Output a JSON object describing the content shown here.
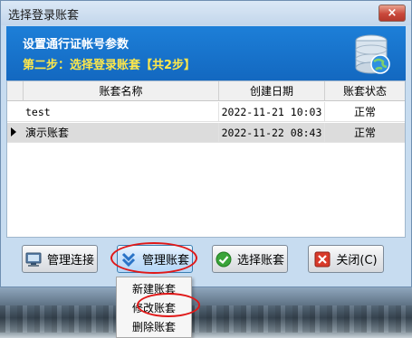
{
  "window": {
    "title": "选择登录账套",
    "close_label": "×"
  },
  "banner": {
    "title": "设置通行证帐号参数",
    "step": "第二步：选择登录账套【共2步】",
    "icon": "database-globe-icon"
  },
  "grid": {
    "columns": [
      "账套名称",
      "创建日期",
      "账套状态"
    ],
    "rows": [
      {
        "name": "test",
        "date": "2022-11-21 10:03",
        "status": "正常",
        "selected": false
      },
      {
        "name": "演示账套",
        "date": "2022-11-22 08:43",
        "status": "正常",
        "selected": true
      }
    ]
  },
  "buttons": {
    "manage_conn": "管理连接",
    "manage_ledger": "管理账套",
    "select_ledger": "选择账套",
    "close": "关闭(C)"
  },
  "menu": {
    "items": [
      "新建账套",
      "修改账套",
      "删除账套"
    ]
  },
  "colors": {
    "banner": "#1368c0",
    "step_text": "#ffe84a",
    "highlight_ring": "#e01818"
  }
}
